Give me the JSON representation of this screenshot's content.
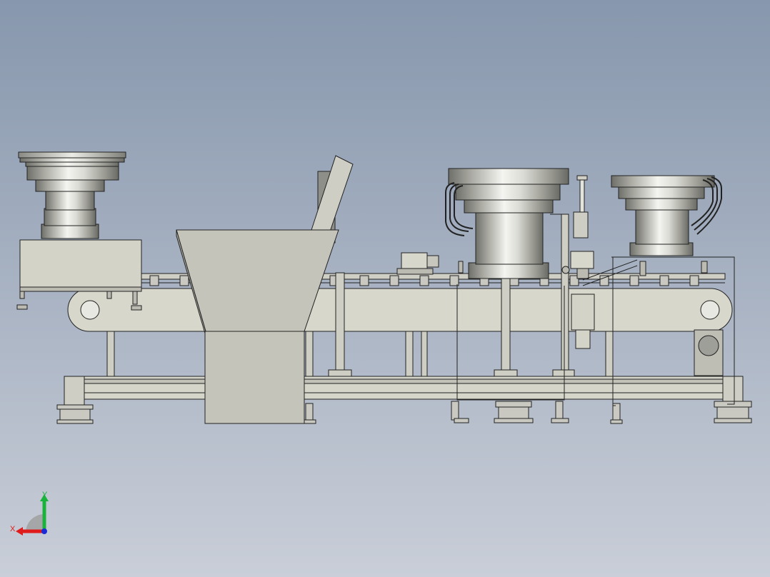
{
  "viewport": {
    "background_top": "#8797ad",
    "background_bottom": "#c9ced8",
    "stroke_color": "#222222",
    "metal_light": "#f2f2ee",
    "metal_mid": "#b9b9b2",
    "metal_dark": "#6f6f6a",
    "panel_fill": "#d4d3c8"
  },
  "triad": {
    "x_label": "X",
    "y_label": "Y",
    "x_color": "#e01b1b",
    "y_color": "#19b33b",
    "z_color": "#1b2bd6"
  },
  "icons": [
    "coordinate-triad-icon"
  ]
}
